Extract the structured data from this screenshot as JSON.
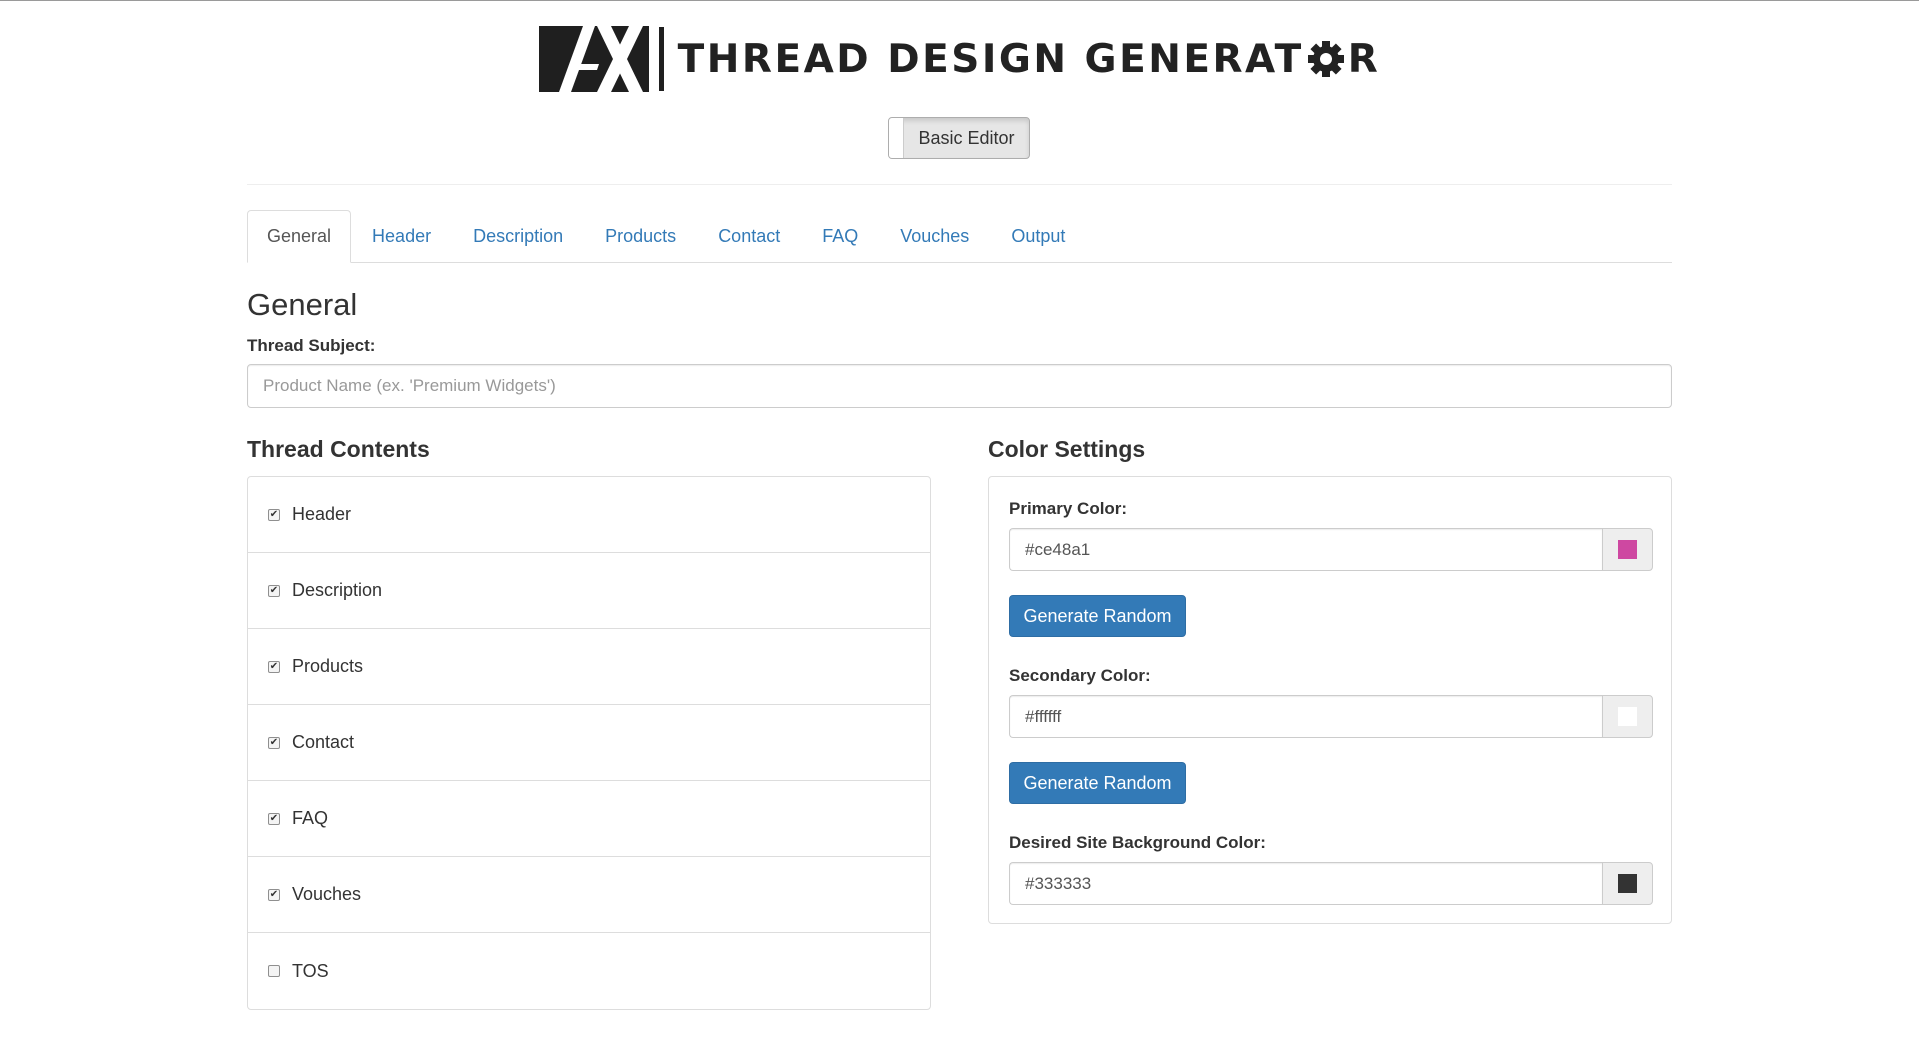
{
  "logo": {
    "title": "THREAD DESIGN GENERAT",
    "title_tail": "R"
  },
  "mode_toggle": {
    "label": "Basic Editor"
  },
  "tabs": [
    {
      "label": "General",
      "active": true
    },
    {
      "label": "Header",
      "active": false
    },
    {
      "label": "Description",
      "active": false
    },
    {
      "label": "Products",
      "active": false
    },
    {
      "label": "Contact",
      "active": false
    },
    {
      "label": "FAQ",
      "active": false
    },
    {
      "label": "Vouches",
      "active": false
    },
    {
      "label": "Output",
      "active": false
    }
  ],
  "general": {
    "title": "General",
    "subject_label": "Thread Subject:",
    "subject_placeholder": "Product Name (ex. 'Premium Widgets')",
    "subject_value": ""
  },
  "thread_contents": {
    "heading": "Thread Contents",
    "items": [
      {
        "label": "Header",
        "checked": true
      },
      {
        "label": "Description",
        "checked": true
      },
      {
        "label": "Products",
        "checked": true
      },
      {
        "label": "Contact",
        "checked": true
      },
      {
        "label": "FAQ",
        "checked": true
      },
      {
        "label": "Vouches",
        "checked": true
      },
      {
        "label": "TOS",
        "checked": false
      }
    ]
  },
  "color_settings": {
    "heading": "Color Settings",
    "primary": {
      "label": "Primary Color:",
      "value": "#ce48a1",
      "swatch": "#ce48a1",
      "button": "Generate Random"
    },
    "secondary": {
      "label": "Secondary Color:",
      "value": "#ffffff",
      "swatch": "#ffffff",
      "button": "Generate Random"
    },
    "background": {
      "label": "Desired Site Background Color:",
      "value": "#333333",
      "swatch": "#333333"
    }
  },
  "colors": {
    "link": "#337ab7",
    "button_primary": "#337ab7",
    "border": "#dddddd"
  }
}
